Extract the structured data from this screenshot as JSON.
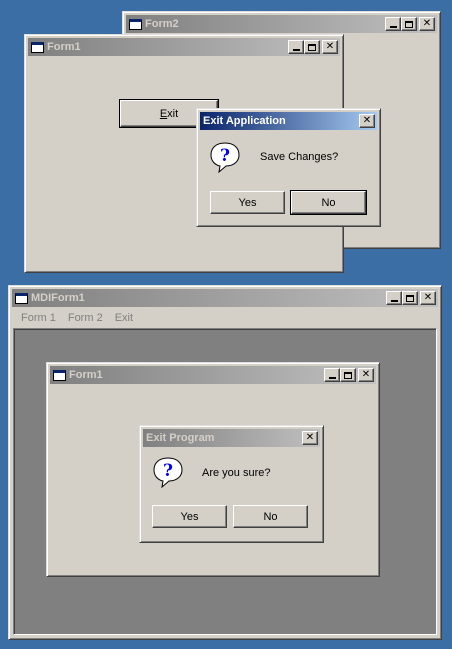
{
  "top_scene": {
    "form2": {
      "title": "Form2"
    },
    "form1": {
      "title": "Form1",
      "exit_button": "Exit",
      "exit_mnemonic": "E",
      "exit_rest": "xit"
    },
    "dialog": {
      "title": "Exit Application",
      "message": "Save Changes?",
      "yes_label": "Yes",
      "no_label": "No",
      "icon": "question-icon"
    }
  },
  "mdi_scene": {
    "mdi_form": {
      "title": "MDIForm1"
    },
    "menu": [
      "Form 1",
      "Form 2",
      "Exit"
    ],
    "child_form": {
      "title": "Form1"
    },
    "dialog": {
      "title": "Exit Program",
      "message": "Are you sure?",
      "yes_label": "Yes",
      "no_label": "No",
      "icon": "question-icon"
    }
  },
  "colors": {
    "desktop": "#3a6ea5",
    "window_face": "#d4d0c8",
    "active_title_start": "#0a246a",
    "active_title_end": "#a6caf0",
    "inactive_title_start": "#808080",
    "mdi_client": "#808080"
  }
}
